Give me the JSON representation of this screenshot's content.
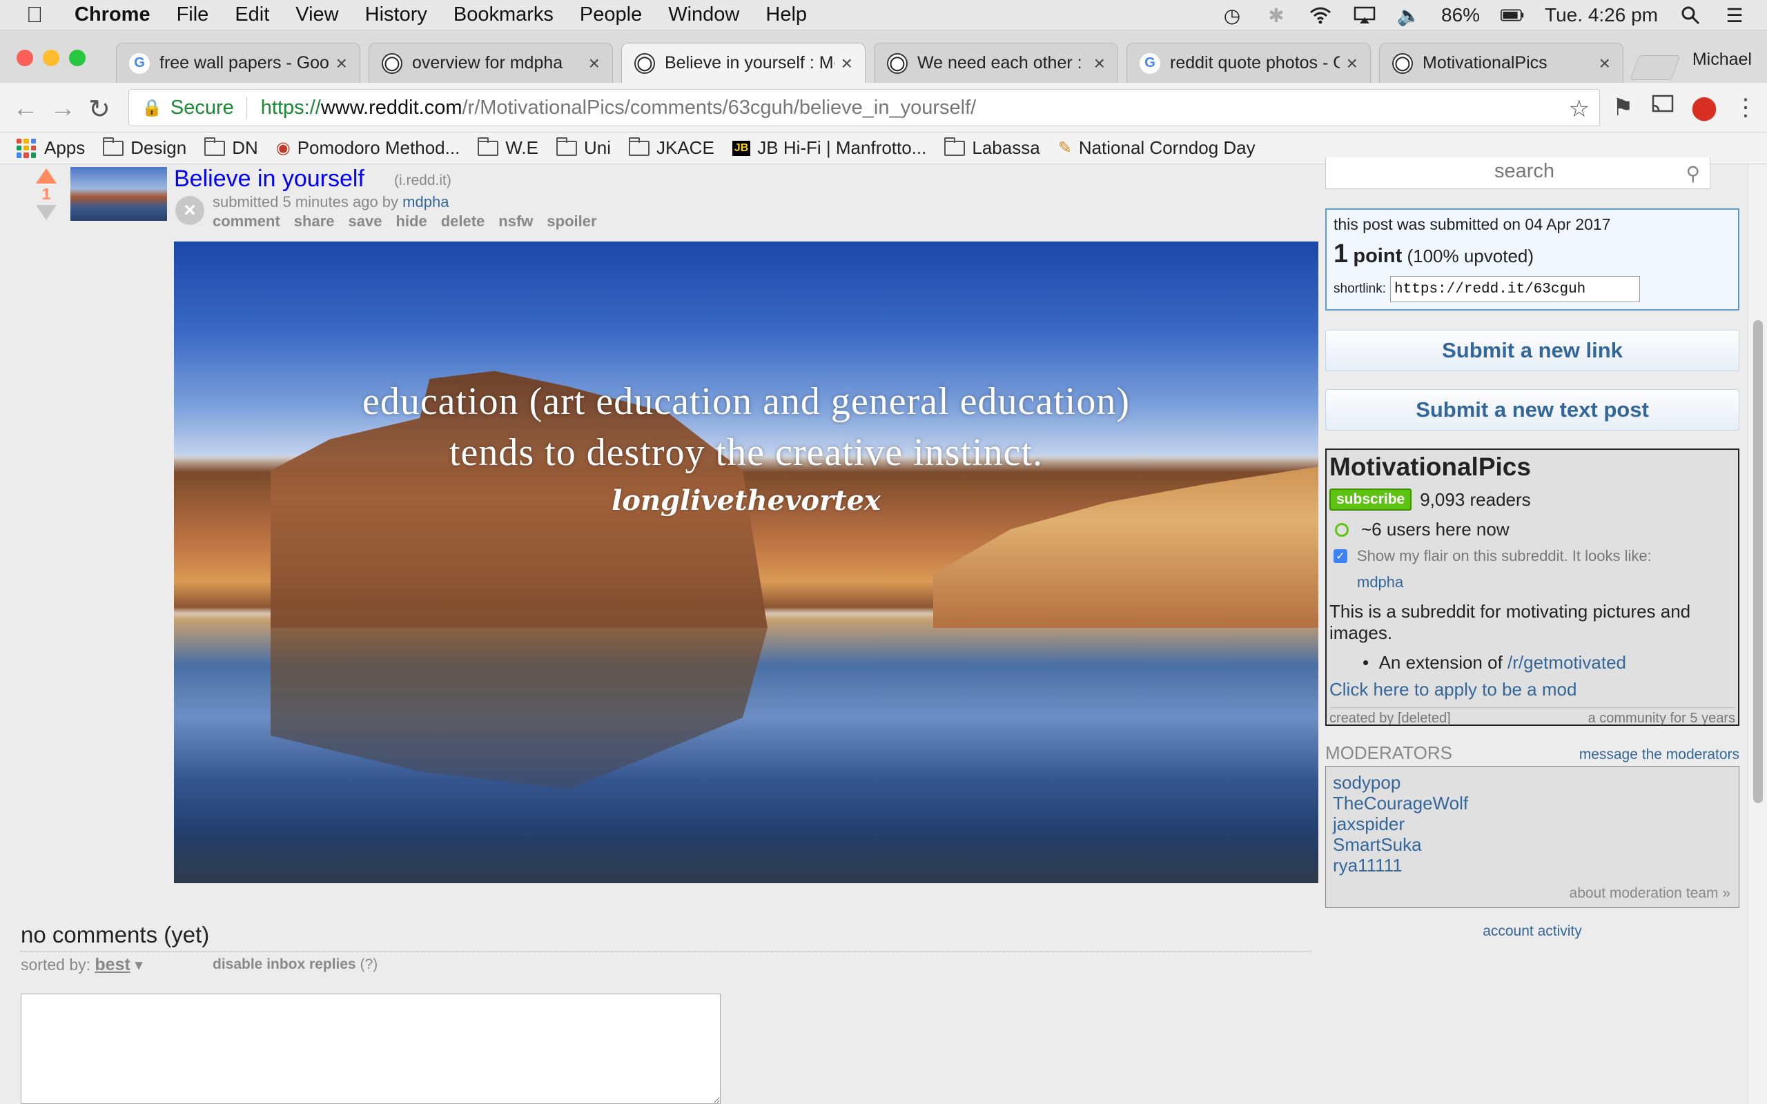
{
  "menubar": {
    "app": "Chrome",
    "items": [
      "File",
      "Edit",
      "View",
      "History",
      "Bookmarks",
      "People",
      "Window",
      "Help"
    ],
    "battery": "86%",
    "clock": "Tue. 4:26 pm"
  },
  "tabs": [
    {
      "title": "free wall papers - Goo",
      "favicon": "google-icon"
    },
    {
      "title": "overview for mdpha",
      "favicon": "reddit-icon"
    },
    {
      "title": "Believe in yourself : Mo",
      "favicon": "reddit-icon",
      "active": true
    },
    {
      "title": "We need each other : F",
      "favicon": "reddit-icon"
    },
    {
      "title": "reddit quote photos - G",
      "favicon": "google-icon"
    },
    {
      "title": "MotivationalPics",
      "favicon": "reddit-icon"
    }
  ],
  "profile": "Michael",
  "address": {
    "secure_label": "Secure",
    "scheme": "https://",
    "host": "www.reddit.com",
    "path": "/r/MotivationalPics/comments/63cguh/believe_in_yourself/"
  },
  "bookmarks": [
    "Apps",
    "Design",
    "DN",
    "Pomodoro Method...",
    "W.E",
    "Uni",
    "JKACE",
    "JB Hi-Fi | Manfrotto...",
    "Labassa",
    "National Corndog Day"
  ],
  "post": {
    "score": "1",
    "title": "Believe in yourself",
    "domain": "(i.redd.it)",
    "submitted": "submitted 5 minutes ago by",
    "author": "mdpha",
    "actions": [
      "comment",
      "share",
      "save",
      "hide",
      "delete",
      "nsfw",
      "spoiler"
    ],
    "image_quote_line1": "education (art education and general education)",
    "image_quote_line2": "tends to destroy the creative instinct.",
    "image_signature": "longlivethevortex"
  },
  "comments": {
    "title": "no comments (yet)",
    "sorted_label": "sorted by:",
    "sort_value": "best",
    "disable_inbox": "disable inbox replies",
    "help": "(?)"
  },
  "sidebar": {
    "search_placeholder": "search",
    "submitted_on": "this post was submitted on 04 Apr 2017",
    "points_num": "1",
    "points_word": "point",
    "upvoted": "(100% upvoted)",
    "shortlink_label": "shortlink:",
    "shortlink": "https://redd.it/63cguh",
    "submit_link": "Submit a new link",
    "submit_text": "Submit a new text post",
    "subreddit": "MotivationalPics",
    "subscribe": "subscribe",
    "readers": "9,093 readers",
    "online": "~6 users here now",
    "flair_label": "Show my flair on this subreddit. It looks like:",
    "flair_user": "mdpha",
    "description": "This is a subreddit for motivating pictures and images.",
    "extension_prefix": "An extension of ",
    "extension_link": "/r/getmotivated",
    "apply_mod": "Click here to apply to be a mod",
    "created_by": "created by [deleted]",
    "community_age": "a community for 5 years",
    "moderators_title": "MODERATORS",
    "message_mods": "message the moderators",
    "moderators": [
      "sodypop",
      "TheCourageWolf",
      "jaxspider",
      "SmartSuka",
      "rya11111"
    ],
    "about_mod": "about moderation team »",
    "account_activity": "account activity"
  }
}
